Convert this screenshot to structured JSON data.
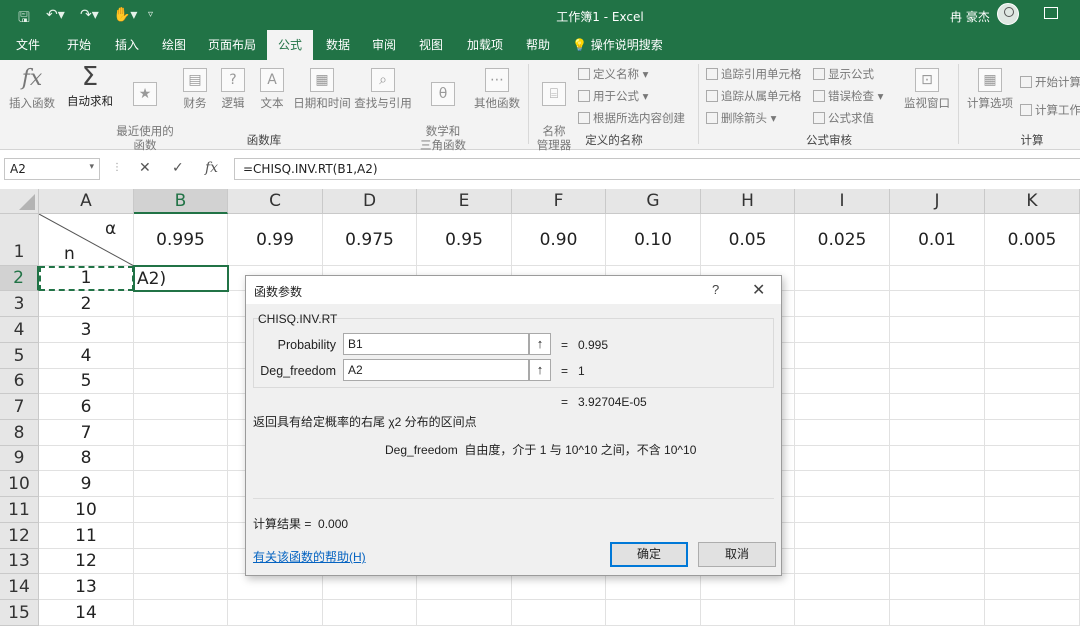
{
  "titlebar": {
    "title": "工作簿1 - Excel",
    "user": "冉 豪杰"
  },
  "tabs": [
    "文件",
    "开始",
    "插入",
    "绘图",
    "页面布局",
    "公式",
    "数据",
    "审阅",
    "视图",
    "加载项",
    "帮助",
    "操作说明搜索"
  ],
  "active_tab": "公式",
  "ribbon": {
    "function_library": {
      "label": "函数库",
      "insert_function": "插入函数",
      "autosum": "自动求和",
      "recent": "最近使用的\n函数",
      "financial": "财务",
      "logical": "逻辑",
      "text": "文本",
      "datetime": "日期和时间",
      "lookup": "查找与引用",
      "math": "数学和\n三角函数",
      "more": "其他函数"
    },
    "defined_names": {
      "label": "定义的名称",
      "name_manager": "名称\n管理器",
      "define_name": "定义名称",
      "use_in_formula": "用于公式",
      "create_from_selection": "根据所选内容创建"
    },
    "formula_auditing": {
      "label": "公式审核",
      "trace_precedents": "追踪引用单元格",
      "trace_dependents": "追踪从属单元格",
      "remove_arrows": "删除箭头",
      "show_formulas": "显示公式",
      "error_checking": "错误检查",
      "evaluate_formula": "公式求值",
      "watch_window": "监视窗口"
    },
    "calculation": {
      "label": "计算",
      "calc_options": "计算选项",
      "calc_now": "开始计算",
      "calc_sheet": "计算工作"
    }
  },
  "formula_bar": {
    "name_box": "A2",
    "formula": "=CHISQ.INV.RT(B1,A2)"
  },
  "sheet": {
    "columns": [
      "A",
      "B",
      "C",
      "D",
      "E",
      "F",
      "G",
      "H",
      "I",
      "J",
      "K"
    ],
    "rows": [
      "1",
      "2",
      "3",
      "4",
      "5",
      "6",
      "7",
      "8",
      "9",
      "10",
      "11",
      "12",
      "13",
      "14",
      "15"
    ],
    "a1_alpha": "α",
    "a1_n": "n",
    "row1_values": [
      "0.995",
      "0.99",
      "0.975",
      "0.95",
      "0.90",
      "0.10",
      "0.05",
      "0.025",
      "0.01",
      "0.005"
    ],
    "col_a_values": [
      "1",
      "2",
      "3",
      "4",
      "5",
      "6",
      "7",
      "8",
      "9",
      "10",
      "11",
      "12",
      "13",
      "14"
    ],
    "b2_text": "A2)"
  },
  "dialog": {
    "title": "函数参数",
    "help": "?",
    "function_name": "CHISQ.INV.RT",
    "args": [
      {
        "label": "Probability",
        "value": "B1",
        "result": "0.995"
      },
      {
        "label": "Deg_freedom",
        "value": "A2",
        "result": "1"
      }
    ],
    "equals": "=",
    "formula_result": "3.92704E-05",
    "description": "返回具有给定概率的右尾 χ2 分布的区间点",
    "param_name": "Deg_freedom",
    "param_description": "自由度，介于 1 与 10^10 之间，不含 10^10",
    "calc_result_label": "计算结果 =",
    "calc_result_value": "0.000",
    "help_link": "有关该函数的帮助(H)",
    "ok": "确定",
    "cancel": "取消"
  }
}
